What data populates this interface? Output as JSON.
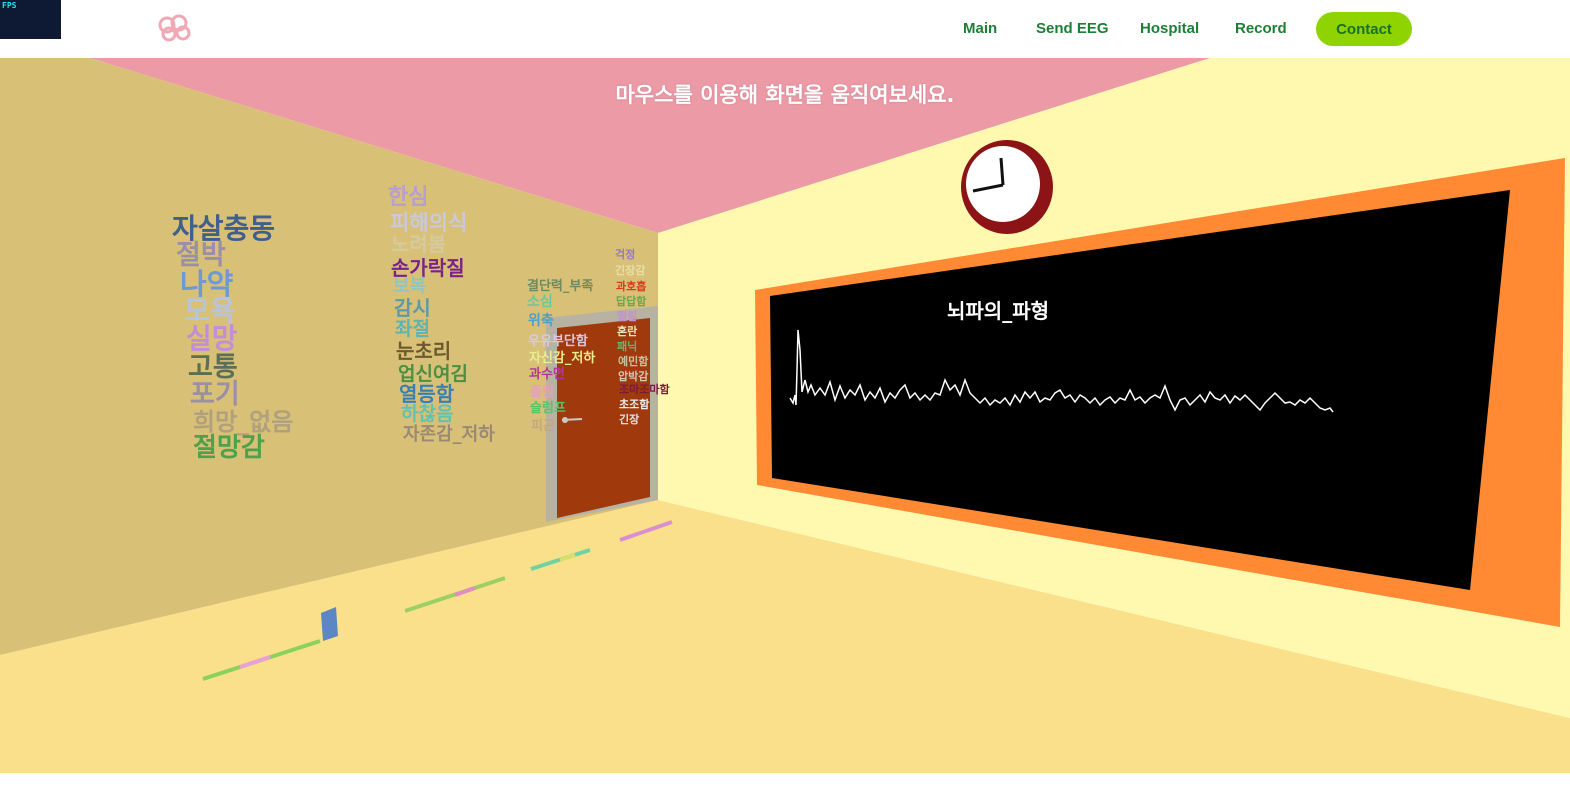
{
  "fps_label": "FPS",
  "nav": {
    "items": [
      "Main",
      "Send EEG",
      "Hospital",
      "Record"
    ],
    "contact": "Contact"
  },
  "instruction": "마우스를 이용해 화면을 움직여보세요.",
  "board_title": "뇌파의_파형",
  "word_clouds": {
    "group1": [
      "자살충동",
      "절박",
      "나약",
      "모욕",
      "실망",
      "고통",
      "포기",
      "희망_없음",
      "절망감"
    ],
    "group2": [
      "한심",
      "피해의식",
      "노려봄",
      "손가락질",
      "보복",
      "감시",
      "좌절",
      "눈초리",
      "업신여김",
      "열등함",
      "하찮음",
      "자존감_저하"
    ],
    "group3": [
      "결단력_부족",
      "소심",
      "위축",
      "우유부단함",
      "자신감_저하",
      "과수면",
      "졸림",
      "슬럼프",
      "피곤"
    ],
    "group4": [
      "걱정",
      "긴장감",
      "과호흡",
      "답답함",
      "떨림",
      "혼란",
      "패닉",
      "예민함",
      "압박감",
      "조마조마함",
      "초조함",
      "긴장"
    ]
  },
  "colors": {
    "nav_text": "#1d7f35",
    "contact_bg": "#8fd400",
    "ceiling": "#eb9aa6",
    "left_wall": "#d8c076",
    "right_wall": "#fff9b0",
    "floor": "#fbe08c",
    "board_frame": "#ff8a33",
    "board": "#000000"
  }
}
